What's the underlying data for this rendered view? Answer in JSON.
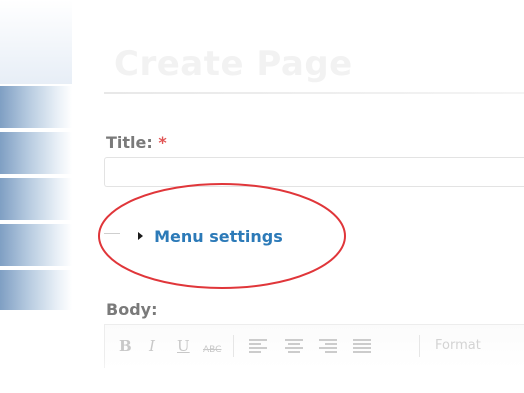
{
  "page": {
    "title": "Create Page"
  },
  "form": {
    "title_label": "Title:",
    "required_marker": "*",
    "title_value": "",
    "menu_settings_label": "Menu settings",
    "body_label": "Body:"
  },
  "editor_toolbar": {
    "bold": "B",
    "italic": "I",
    "underline": "U",
    "strikethrough": "ABC",
    "format_label": "Format"
  },
  "colors": {
    "link": "#2c7ab8",
    "required": "#e15555",
    "highlight_circle": "#e0363a",
    "sidebar_tab": "#7f9fc3"
  },
  "icons": {
    "collapse_toggle": "triangle-right"
  }
}
